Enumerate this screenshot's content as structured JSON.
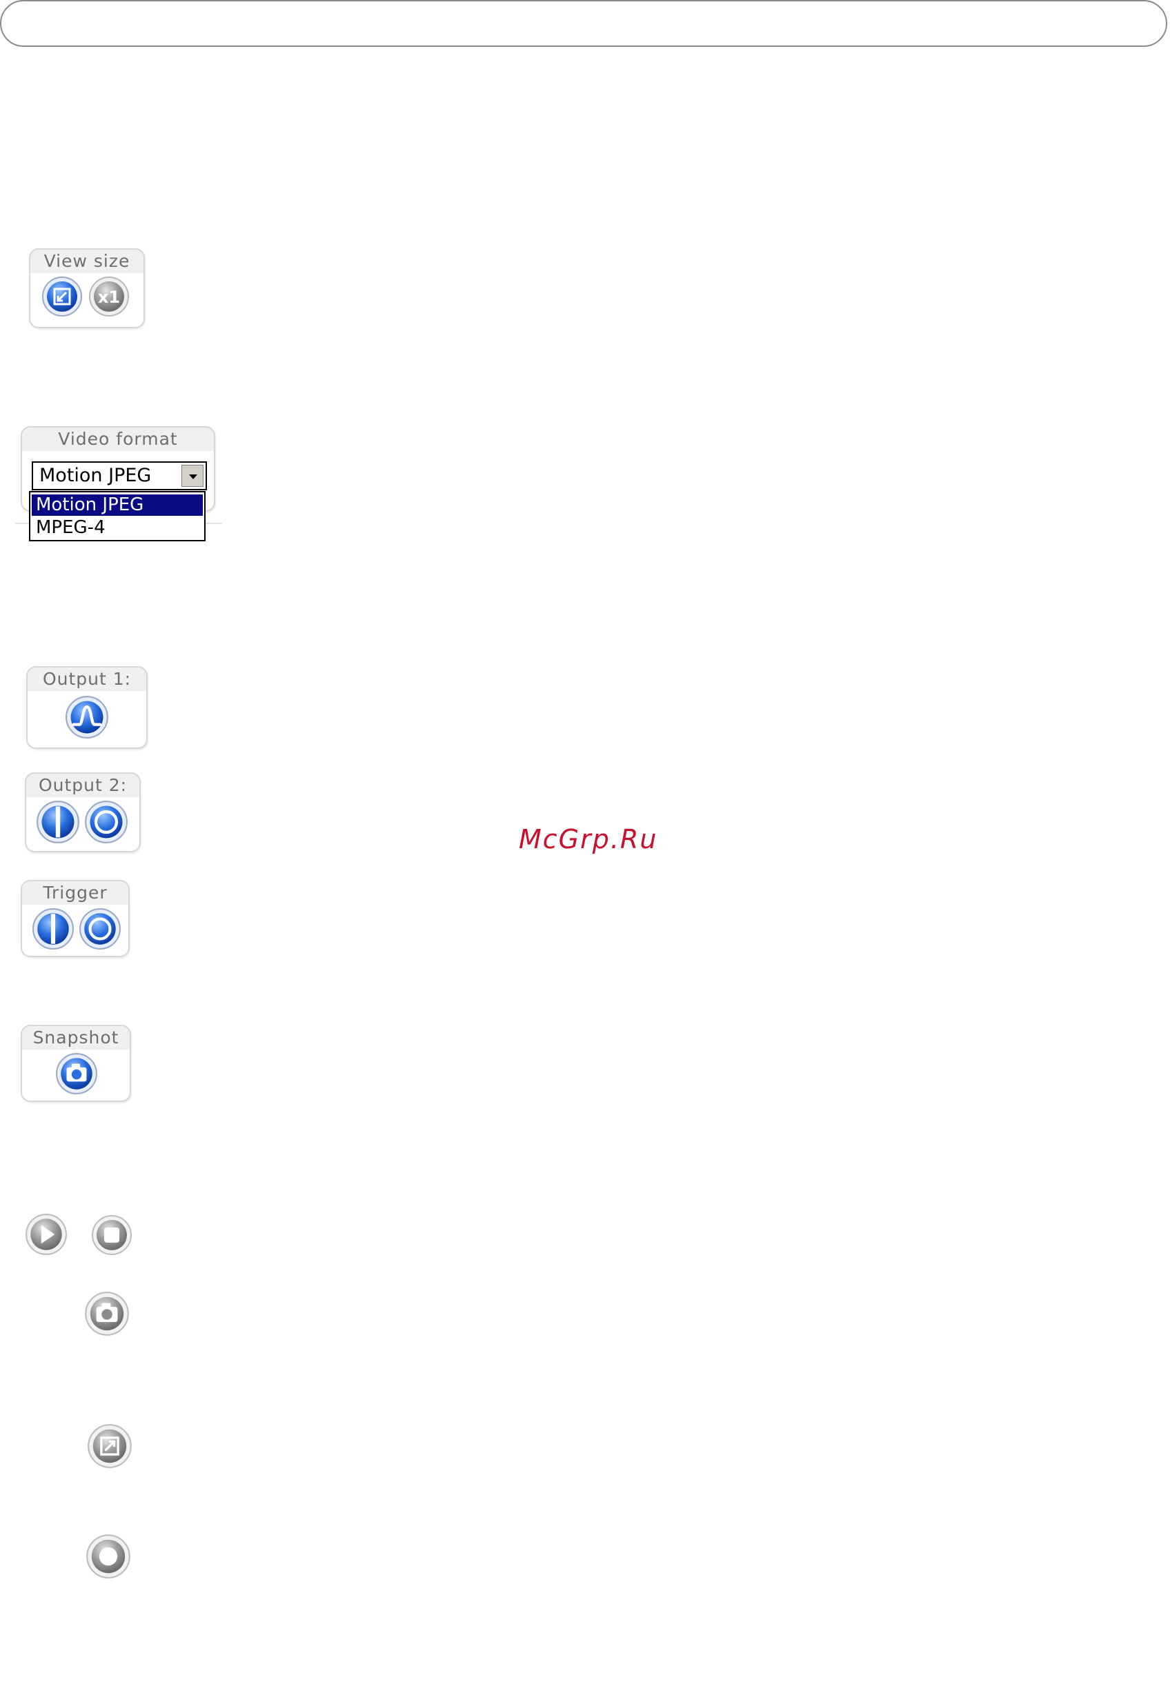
{
  "view_size": {
    "title": "View size",
    "buttons": [
      {
        "icon": "fit-window-icon",
        "state": "active"
      },
      {
        "icon": "x1-icon",
        "label": "x1",
        "state": "inactive"
      }
    ]
  },
  "video_format": {
    "title": "Video format",
    "selected": "Motion JPEG",
    "options": [
      "Motion JPEG",
      "MPEG-4"
    ]
  },
  "output1": {
    "title": "Output 1:",
    "button_icon": "pulse-icon"
  },
  "output2": {
    "title": "Output 2:",
    "buttons": [
      "on-icon",
      "off-icon"
    ]
  },
  "trigger": {
    "title": "Trigger",
    "buttons": [
      "on-icon",
      "off-icon"
    ]
  },
  "snapshot": {
    "title": "Snapshot",
    "button_icon": "camera-icon"
  },
  "toolbar_buttons": [
    "play-icon",
    "stop-icon",
    "camera-icon",
    "fullscreen-icon",
    "record-icon"
  ],
  "watermark": "McGrp.Ru",
  "colors": {
    "accent_blue": "#1f5fd6",
    "gray_button": "#8c8c8c",
    "selection_bg": "#0a0a84"
  }
}
